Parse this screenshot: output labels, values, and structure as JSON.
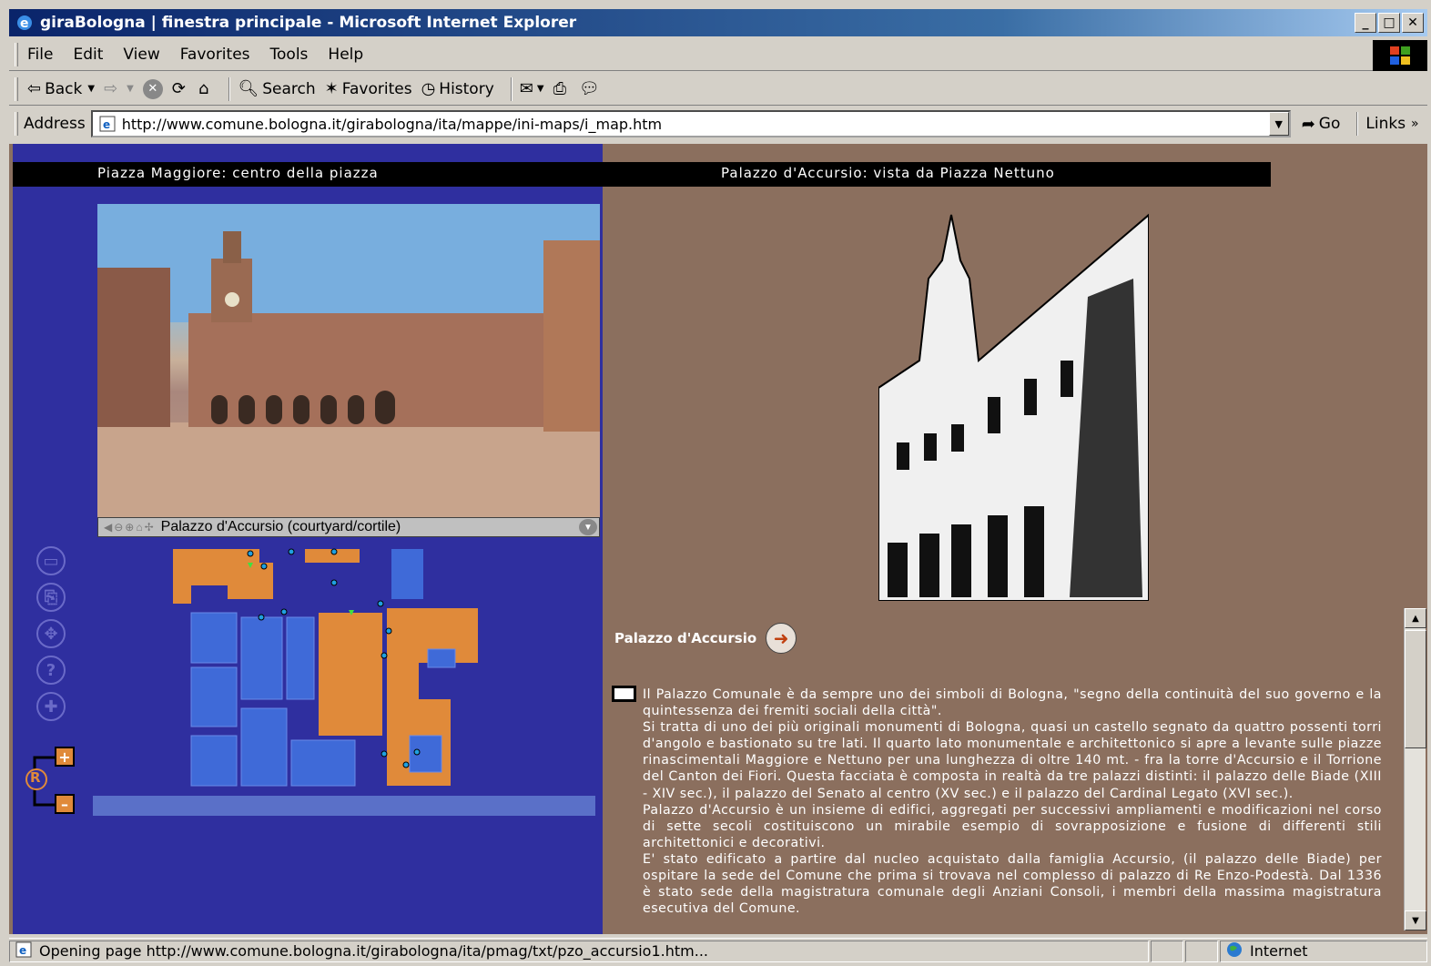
{
  "window": {
    "title": "giraBologna | finestra principale - Microsoft Internet Explorer",
    "controls": {
      "minimize": "_",
      "maximize": "□",
      "close": "✕"
    }
  },
  "menu": {
    "items": [
      {
        "label": "File"
      },
      {
        "label": "Edit"
      },
      {
        "label": "View"
      },
      {
        "label": "Favorites"
      },
      {
        "label": "Tools"
      },
      {
        "label": "Help"
      }
    ]
  },
  "toolbar": {
    "back": "Back",
    "search": "Search",
    "favorites": "Favorites",
    "history": "History"
  },
  "address": {
    "label": "Address",
    "url": "http://www.comune.bologna.it/girabologna/ita/mappe/ini-maps/i_map.htm",
    "go": "Go",
    "links": "Links",
    "more": "»"
  },
  "page": {
    "left_title": "Piazza Maggiore: centro della piazza",
    "right_title": "Palazzo d'Accursio: vista da Piazza Nettuno",
    "photo_caption": "Palazzo d'Accursio (courtyard/cortile)",
    "side_buttons": [
      "▭",
      "⎘",
      "✥",
      "?",
      "✚"
    ],
    "zoom_label": "R",
    "zoom_in": "+",
    "zoom_out": "–",
    "heading": "Palazzo d'Accursio",
    "paragraphs": [
      "Il Palazzo Comunale è da sempre uno dei simboli di Bologna, \"segno della continuità del suo governo e la quintessenza dei fremiti sociali della città\".",
      "Si tratta di uno dei più originali monumenti di Bologna, quasi un castello segnato da quattro possenti torri d'angolo e bastionato su tre lati. Il quarto lato monumentale e architettonico si apre a levante sulle piazze rinascimentali Maggiore e Nettuno per una lunghezza di oltre 140 mt. - fra la torre d'Accursio e il Torrione del Canton dei Fiori. Questa facciata è composta in realtà da tre palazzi distinti: il palazzo delle Biade (XIII - XIV sec.), il palazzo del Senato al centro (XV sec.) e il palazzo del Cardinal Legato (XVI sec.).",
      "Palazzo d'Accursio è un insieme di edifici, aggregati per successivi ampliamenti e modificazioni nel corso di sette secoli costituiscono un mirabile esempio di sovrapposizione e fusione di differenti stili architettonici e decorativi.",
      "E' stato edificato a partire dal nucleo acquistato dalla famiglia Accursio, (il palazzo delle Biade) per ospitare la sede del Comune che prima si trovava nel complesso di palazzo di Re Enzo-Podestà. Dal 1336 è stato sede della magistratura comunale degli Anziani Consoli, i membri della massima magistratura esecutiva del Comune."
    ]
  },
  "status": {
    "message": "Opening page http://www.comune.bologna.it/girabologna/ita/pmag/txt/pzo_accursio1.htm...",
    "zone": "Internet"
  },
  "colors": {
    "map_water": "#2f2f9f",
    "map_buildings": "#e08a3a",
    "map_blocks": "#3f6ad8",
    "page_bg": "#8b6f5e"
  }
}
